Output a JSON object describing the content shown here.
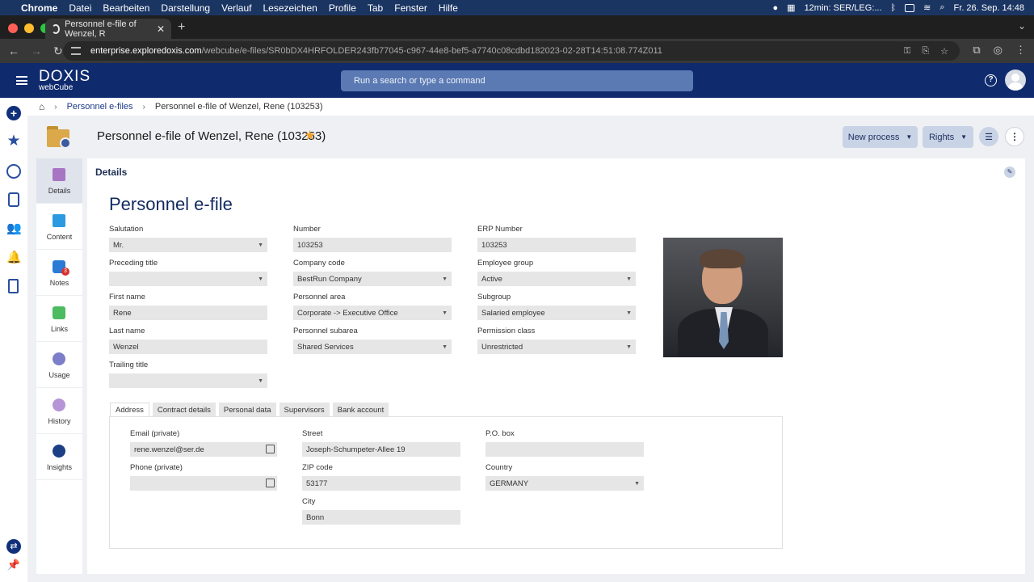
{
  "macbar": {
    "app": "Chrome",
    "menus": [
      "Datei",
      "Bearbeiten",
      "Darstellung",
      "Verlauf",
      "Lesezeichen",
      "Profile",
      "Tab",
      "Fenster",
      "Hilfe"
    ],
    "timer": "12min: SER/LEG:...",
    "clock": "Fr. 26. Sep.  14:48"
  },
  "browser": {
    "tab_title": "Personnel e-file of Wenzel, R",
    "url_host": "enterprise.exploredoxis.com",
    "url_path": "/webcube/e-files/SR0bDX4HRFOLDER243fb77045-c967-44e8-bef5-a7740c08cdbd182023-02-28T14:51:08.774Z011"
  },
  "app": {
    "logo_line1": "DOXIS",
    "logo_line2": "webCube",
    "search_placeholder": "Run a search or type a command"
  },
  "breadcrumb": {
    "items": [
      "Personnel e-files",
      "Personnel e-file of Wenzel, Rene (103253)"
    ]
  },
  "document": {
    "title": "Personnel e-file of Wenzel, Rene (103253)",
    "new_process_label": "New process",
    "rights_label": "Rights"
  },
  "sidenav": {
    "items": [
      {
        "label": "Details"
      },
      {
        "label": "Content"
      },
      {
        "label": "Notes",
        "badge": "3"
      },
      {
        "label": "Links"
      },
      {
        "label": "Usage"
      },
      {
        "label": "History"
      },
      {
        "label": "Insights"
      }
    ]
  },
  "panel": {
    "title": "Details",
    "heading": "Personnel e-file"
  },
  "form": {
    "salutation": {
      "label": "Salutation",
      "value": "Mr."
    },
    "preceding_title": {
      "label": "Preceding title",
      "value": ""
    },
    "first_name": {
      "label": "First name",
      "value": "Rene"
    },
    "last_name": {
      "label": "Last name",
      "value": "Wenzel"
    },
    "trailing_title": {
      "label": "Trailing title",
      "value": ""
    },
    "number": {
      "label": "Number",
      "value": "103253"
    },
    "company_code": {
      "label": "Company code",
      "value": "BestRun Company"
    },
    "personnel_area": {
      "label": "Personnel area",
      "value": "Corporate -> Executive Office"
    },
    "personnel_subarea": {
      "label": "Personnel subarea",
      "value": "Shared Services"
    },
    "erp_number": {
      "label": "ERP Number",
      "value": "103253"
    },
    "employee_group": {
      "label": "Employee group",
      "value": "Active"
    },
    "subgroup": {
      "label": "Subgroup",
      "value": "Salaried employee"
    },
    "permission_class": {
      "label": "Permission class",
      "value": "Unrestricted"
    }
  },
  "form_tabs": [
    "Address",
    "Contract details",
    "Personal data",
    "Supervisors",
    "Bank account"
  ],
  "address": {
    "email": {
      "label": "Email (private)",
      "value": "rene.wenzel@ser.de"
    },
    "phone": {
      "label": "Phone (private)",
      "value": ""
    },
    "street": {
      "label": "Street",
      "value": "Joseph-Schumpeter-Allee 19"
    },
    "zip": {
      "label": "ZIP code",
      "value": "53177"
    },
    "city": {
      "label": "City",
      "value": "Bonn"
    },
    "po_box": {
      "label": "P.O. box",
      "value": ""
    },
    "country": {
      "label": "Country",
      "value": "GERMANY"
    }
  },
  "colors": {
    "header": "#0f2b6e",
    "accent": "#f0a330",
    "button": "#c9d3e6"
  }
}
